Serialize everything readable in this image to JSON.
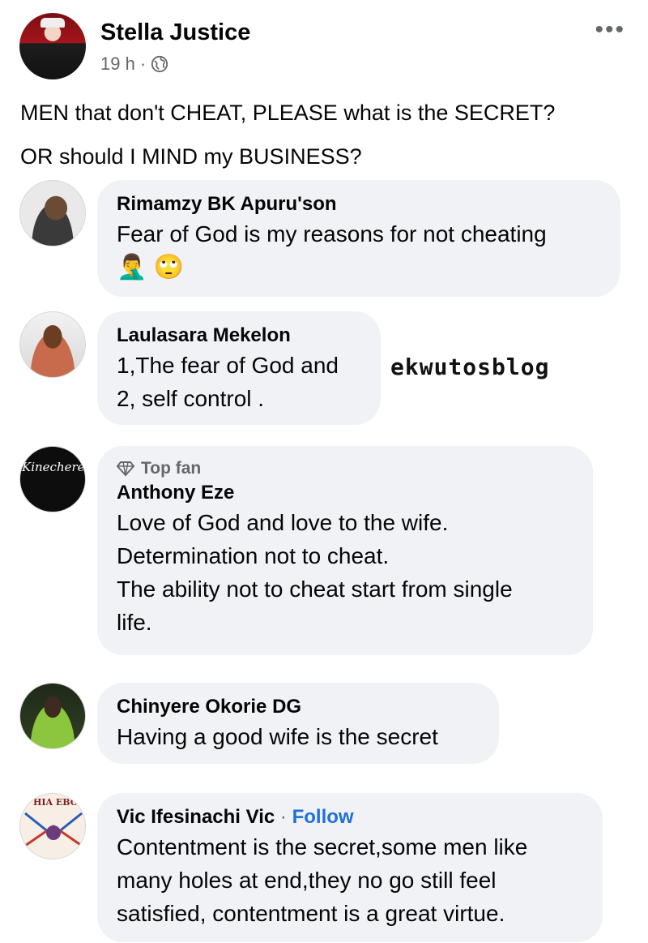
{
  "post": {
    "author": "Stella Justice",
    "time": "19 h",
    "separator": "·",
    "globe_icon": "globe-icon",
    "more_icon": "•••",
    "text_lines": [
      "MEN that don't CHEAT, PLEASE what is the SECRET?",
      "OR should I MIND my BUSINESS?"
    ]
  },
  "watermark": "ekwutosblog",
  "comments": [
    {
      "name": "Rimamzy BK Apuru'son",
      "lines": [
        "Fear of God is my reasons for not cheating"
      ],
      "emojis": "🤦‍♂️ 🙄"
    },
    {
      "name": "Laulasara Mekelon",
      "lines": [
        "1,The fear of God and",
        "2, self control ."
      ]
    },
    {
      "badge": "Top fan",
      "badge_icon": "diamond-icon",
      "name": "Anthony Eze",
      "lines": [
        "Love of God and love to the wife.",
        "Determination not to cheat.",
        "The ability not to cheat start from single",
        "life."
      ],
      "avatar_text": "Kinecherem"
    },
    {
      "name": "Chinyere Okorie DG",
      "lines": [
        "Having a good wife is the secret"
      ]
    },
    {
      "name": "Vic Ifesinachi Vic",
      "separator": "·",
      "follow": "Follow",
      "lines": [
        "Contentment is the secret,some men like",
        "many holes at end,they no go still feel",
        "satisfied, contentment is a great virtue."
      ],
      "avatar_text": "HIA EBON"
    }
  ]
}
